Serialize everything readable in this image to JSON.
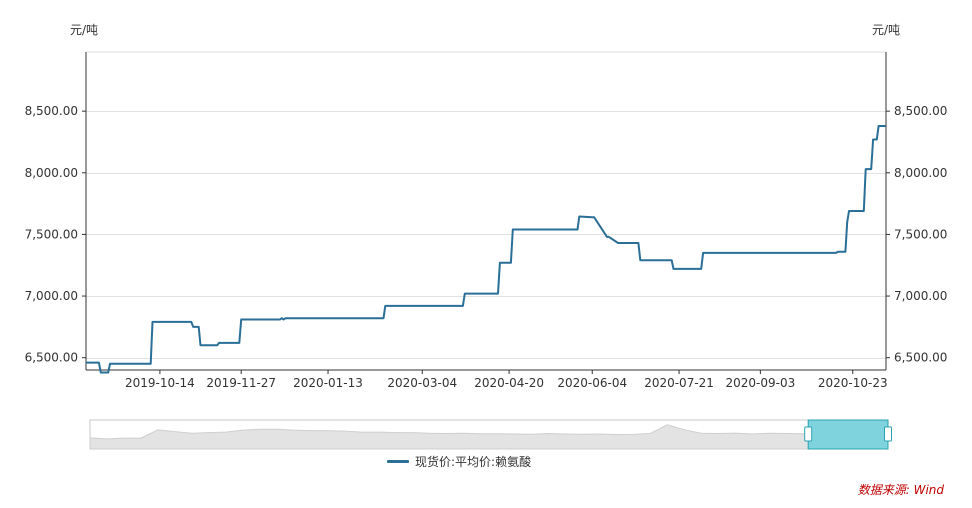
{
  "chart_data": {
    "type": "line",
    "yunit_left": "元/吨",
    "yunit_right": "元/吨",
    "ylim": [
      6400,
      8980
    ],
    "yticks": [
      6500,
      7000,
      7500,
      8000,
      8500
    ],
    "ytick_labels": [
      "6,500.00",
      "7,000.00",
      "7,500.00",
      "8,000.00",
      "8,500.00"
    ],
    "xlim": [
      "2019-09-04",
      "2020-11-10"
    ],
    "xtick_labels": [
      "2019-10-14",
      "2019-11-27",
      "2020-01-13",
      "2020-03-04",
      "2020-04-20",
      "2020-06-04",
      "2020-07-21",
      "2020-09-03",
      "2020-10-23"
    ],
    "grid": true,
    "legend_position": "bottom-center",
    "series": [
      {
        "name": "现货价:平均价:赖氨酸",
        "color": "#2a6f97",
        "x": [
          "2019-09-04",
          "2019-09-11",
          "2019-09-12",
          "2019-09-16",
          "2019-09-17",
          "2019-10-09",
          "2019-10-10",
          "2019-10-31",
          "2019-11-01",
          "2019-11-04",
          "2019-11-05",
          "2019-11-14",
          "2019-11-15",
          "2019-11-26",
          "2019-11-27",
          "2019-12-18",
          "2019-12-19",
          "2019-12-20",
          "2019-12-21",
          "2020-02-12",
          "2020-02-13",
          "2020-03-26",
          "2020-03-27",
          "2020-04-14",
          "2020-04-15",
          "2020-04-21",
          "2020-04-22",
          "2020-05-27",
          "2020-05-28",
          "2020-06-04",
          "2020-06-05",
          "2020-06-12",
          "2020-06-13",
          "2020-06-18",
          "2020-06-19",
          "2020-06-29",
          "2020-06-30",
          "2020-07-17",
          "2020-07-18",
          "2020-08-02",
          "2020-08-03",
          "2020-10-14",
          "2020-10-15",
          "2020-10-19",
          "2020-10-20",
          "2020-10-21",
          "2020-10-29",
          "2020-10-30",
          "2020-11-02",
          "2020-11-03",
          "2020-11-05",
          "2020-11-06",
          "2020-11-10"
        ],
        "y": [
          6460,
          6460,
          6380,
          6380,
          6450,
          6450,
          6790,
          6790,
          6750,
          6750,
          6600,
          6600,
          6620,
          6620,
          6810,
          6810,
          6820,
          6810,
          6820,
          6820,
          6920,
          6920,
          7020,
          7020,
          7270,
          7270,
          7540,
          7540,
          7645,
          7640,
          7640,
          7480,
          7480,
          7430,
          7430,
          7430,
          7290,
          7290,
          7220,
          7220,
          7350,
          7350,
          7360,
          7360,
          7600,
          7690,
          7690,
          8030,
          8030,
          8270,
          8270,
          8380,
          8380
        ]
      }
    ]
  },
  "navigator": {
    "profile": [
      6460,
      6420,
      6450,
      6450,
      6790,
      6720,
      6650,
      6680,
      6700,
      6780,
      6820,
      6820,
      6780,
      6760,
      6760,
      6740,
      6700,
      6700,
      6680,
      6680,
      6650,
      6640,
      6650,
      6630,
      6630,
      6620,
      6610,
      6640,
      6620,
      6610,
      6620,
      6600,
      6605,
      6640,
      7000,
      6800,
      6650,
      6640,
      6660,
      6620,
      6650,
      6640,
      6630,
      6620,
      6610,
      6620,
      6600,
      6600
    ],
    "selection_start": 0.9
  },
  "legend": {
    "label": "现货价:平均价:赖氨酸"
  },
  "source": {
    "text": "数据来源: Wind"
  }
}
